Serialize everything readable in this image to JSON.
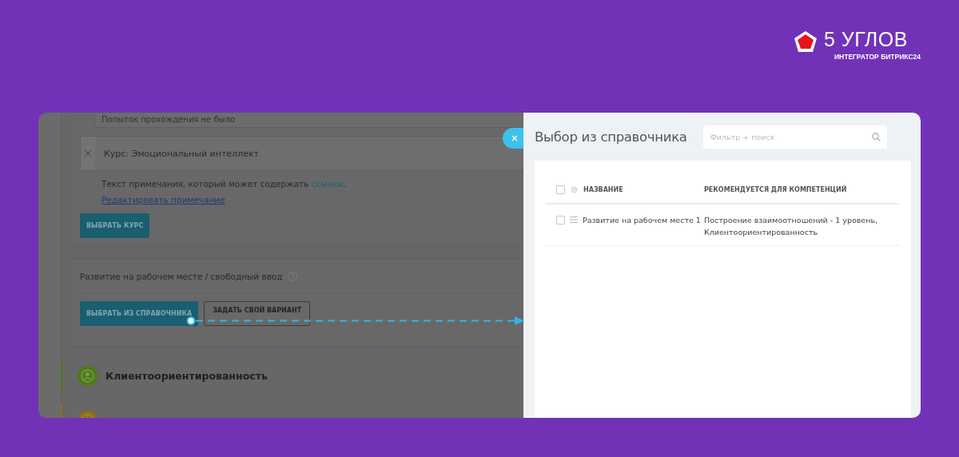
{
  "brand": {
    "name": "5 УГЛОВ",
    "tagline": "ИНТЕГРАТОР БИТРИКС24"
  },
  "background_page": {
    "attempts_note": "Попыток прохождения не было",
    "course": {
      "label": "Курс: Эмоциональный интеллект"
    },
    "note": {
      "text_before": "Текст примечания, который может содержать ",
      "link": "ссылки",
      "text_after": "."
    },
    "edit_note_link": "Редактировать примечание",
    "choose_course_button": "ВЫБРАТЬ КУРС",
    "workplace_section": {
      "title": "Развитие на рабочем месте / свободный ввод",
      "buttons": [
        "ВЫБРАТЬ ИЗ СПРАВОЧНИКА",
        "ЗАДАТЬ СВОЙ ВАРИАНТ"
      ]
    },
    "competencies": [
      {
        "title": "Клиентоориентированность",
        "color": "#4f7a12"
      },
      {
        "color": "#9a6a10"
      }
    ]
  },
  "dialog": {
    "title": "Выбор из справочника",
    "search": {
      "placeholder": "Фильтр + поиск"
    },
    "table": {
      "header_checked": false,
      "columns": [
        "НАЗВАНИЕ",
        "РЕКОМЕНДУЕТСЯ ДЛЯ КОМПЕТЕНЦИЙ"
      ],
      "rows": [
        {
          "checked": false,
          "name": "Развитие на рабочем месте 1",
          "competencies": "Построение взаимоотношений - 1 уровень, Клиентоориентированность"
        }
      ]
    }
  }
}
